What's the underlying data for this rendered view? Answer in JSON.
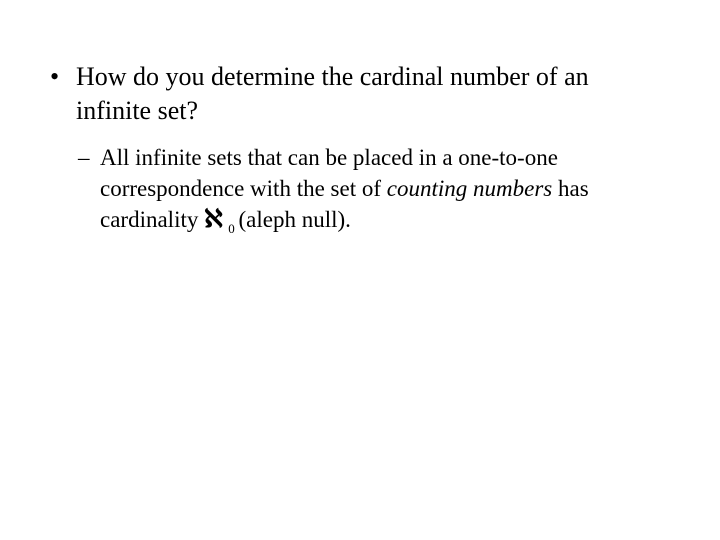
{
  "bullet": {
    "marker": "•",
    "text": "How do you determine the cardinal number of an infinite set?"
  },
  "sub": {
    "marker": "–",
    "part1": "All infinite sets that can be placed in a one-to-one correspondence with the set of ",
    "italic": "counting numbers",
    "part2": " has cardinality ",
    "symbol": "ℵ",
    "subscript": "0",
    "part3": " (aleph null)."
  }
}
